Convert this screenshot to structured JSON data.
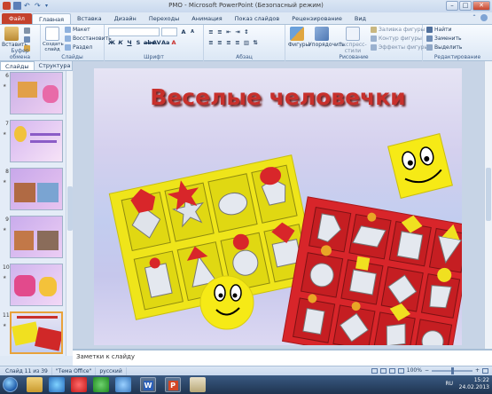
{
  "window": {
    "title": "PMO - Microsoft PowerPoint (Безопасный режим)"
  },
  "tabs": [
    "Файл",
    "Главная",
    "Вставка",
    "Дизайн",
    "Переходы",
    "Анимация",
    "Показ слайдов",
    "Рецензирование",
    "Вид"
  ],
  "ribbon": {
    "clipboard": {
      "paste": "Вставить",
      "group": "Буфер обмена"
    },
    "slides": {
      "create": "Создать слайд",
      "layout": "Макет",
      "reset": "Восстановить",
      "section": "Раздел",
      "group": "Слайды"
    },
    "font": {
      "group": "Шрифт"
    },
    "paragraph": {
      "group": "Абзац"
    },
    "drawing": {
      "shapes": "Фигуры",
      "arrange": "Упорядочить",
      "quickstyles": "Экспресс-стили",
      "fill": "Заливка фигуры",
      "outline": "Контур фигуры",
      "effects": "Эффекты фигуры",
      "group": "Рисование"
    },
    "editing": {
      "find": "Найти",
      "replace": "Заменить",
      "select": "Выделить",
      "group": "Редактирование"
    }
  },
  "pane": {
    "tab_slides": "Слайды",
    "tab_outline": "Структура",
    "close": "x",
    "numbers": [
      "6",
      "7",
      "8",
      "9",
      "10",
      "11"
    ]
  },
  "slide": {
    "title": "Веселые человечки"
  },
  "notes": {
    "placeholder": "Заметки к слайду"
  },
  "status": {
    "slide": "Слайд 11 из 39",
    "theme": "\"Тема Office\"",
    "lang": "русский",
    "zoom": "100%"
  },
  "taskbar": {
    "lang": "RU",
    "time": "15:22",
    "date": "24.02.2013"
  }
}
